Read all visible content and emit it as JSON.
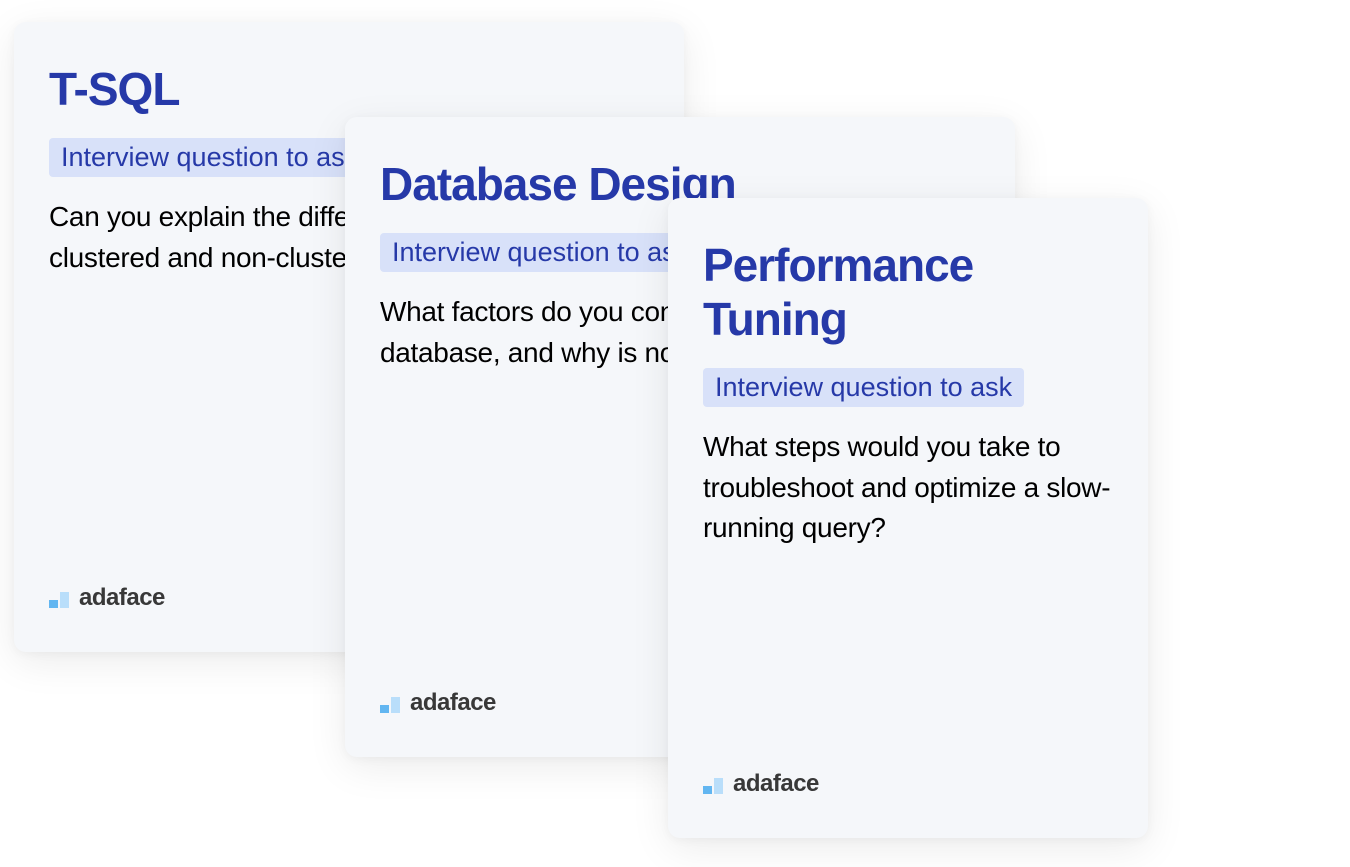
{
  "cards": [
    {
      "title": "T-SQL",
      "badge": "Interview question to ask",
      "question": "Can you explain the difference between a clustered and non-clustered index in SQL?"
    },
    {
      "title": "Database Design",
      "badge": "Interview question to ask",
      "question": "What factors do you consider when normalizing a database, and why is normalization important?"
    },
    {
      "title": "Performance Tuning",
      "badge": "Interview question to ask",
      "question": "What steps would you take to troubleshoot and optimize a slow-running query?"
    }
  ],
  "brand": {
    "name": "adaface"
  }
}
